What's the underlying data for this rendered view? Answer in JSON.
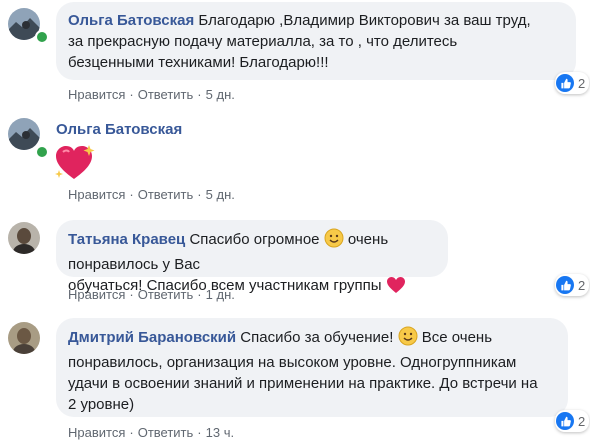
{
  "comments": [
    {
      "author": "Ольга Батовская",
      "text_lines": [
        "Благодарю ,Владимир Викторович за ваш труд,",
        "за прекрасную подачу материалла, за то , что делитесь",
        "безценными техниками! Благодарю!!!"
      ],
      "like_label": "Нравится",
      "reply_label": "Ответить",
      "time": "5 дн.",
      "reaction_count": "2"
    },
    {
      "author": "Ольга Батовская",
      "sticker": "sparkling-heart",
      "like_label": "Нравится",
      "reply_label": "Ответить",
      "time": "5 дн."
    },
    {
      "author": "Татьяна Кравец",
      "text_lines": [
        "Спасибо огромное",
        "очень понравилось у Вас",
        "обучаться! Спасибо всем участникам группы"
      ],
      "like_label": "Нравится",
      "reply_label": "Ответить",
      "time": "1 дн.",
      "reaction_count": "2"
    },
    {
      "author": "Дмитрий Барановский",
      "text_lines": [
        "Спасибо за обучение!",
        "Все очень",
        "понравилось, организация на высоком уровне. Одногруппникам",
        "удачи в освоении знаний и применении на практике. До встречи на",
        "2 уровне)"
      ],
      "like_label": "Нравится",
      "reply_label": "Ответить",
      "time": "13 ч.",
      "reaction_count": "2"
    }
  ],
  "separator": "·",
  "colors": {
    "author": "#385898",
    "bubble": "#f0f2f5",
    "like": "#1877f2",
    "online": "#31a24c"
  }
}
